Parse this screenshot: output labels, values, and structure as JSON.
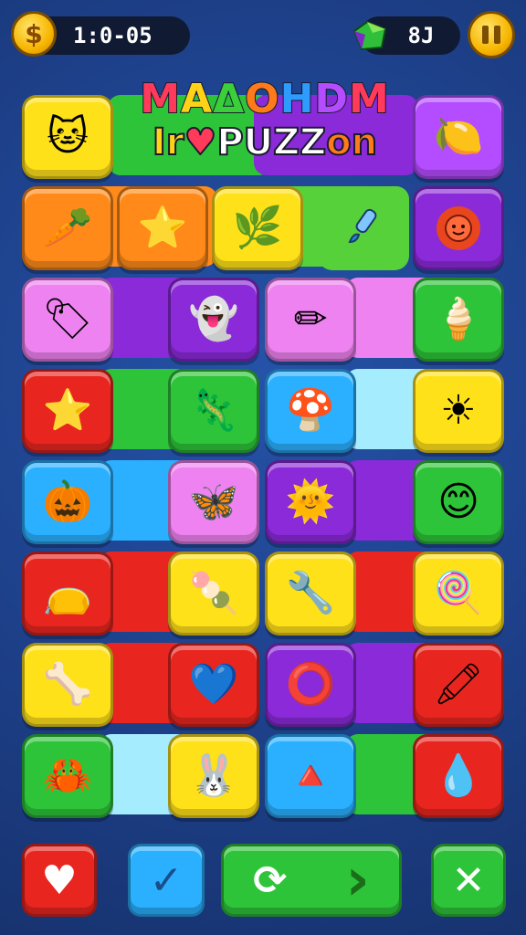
{
  "hud": {
    "coin_icon": "$",
    "timer": "1:0-05",
    "gem_count": "8J"
  },
  "title": {
    "line1": [
      "M",
      "A",
      "Δ",
      "O",
      "H",
      "D",
      "M"
    ],
    "line2": [
      "Ir",
      "♥",
      "PUZZ",
      "on"
    ]
  },
  "colors": {
    "yellow": "#ffe11a",
    "orange": "#ff8a1a",
    "green": "#2ec43a",
    "purple": "#8a2ad8",
    "pink": "#ee82f0",
    "red": "#e8261f",
    "blue": "#2ab0ff",
    "lightblue": "#a6ecff"
  },
  "tiles": [
    [
      "🐱",
      "",
      "",
      "🍋"
    ],
    [
      "🥕",
      "⭐",
      "🌿",
      "🖌"
    ],
    [
      "🏷",
      "👻",
      "✏",
      "🍦"
    ],
    [
      "⭐",
      "🦎",
      "🍄",
      "☀"
    ],
    [
      "🎃",
      "🦋",
      "🌞",
      "😊"
    ],
    [
      "👝",
      "🍡",
      "🔧",
      "🍭"
    ],
    [
      "🦴",
      "💙",
      "⭕",
      "🖍"
    ],
    [
      "🦀",
      "🐰",
      "🔺",
      "💧"
    ]
  ],
  "controls": {
    "heart": "♥",
    "check": "✓",
    "refresh": "⟳",
    "next": "›",
    "close": "✕"
  }
}
